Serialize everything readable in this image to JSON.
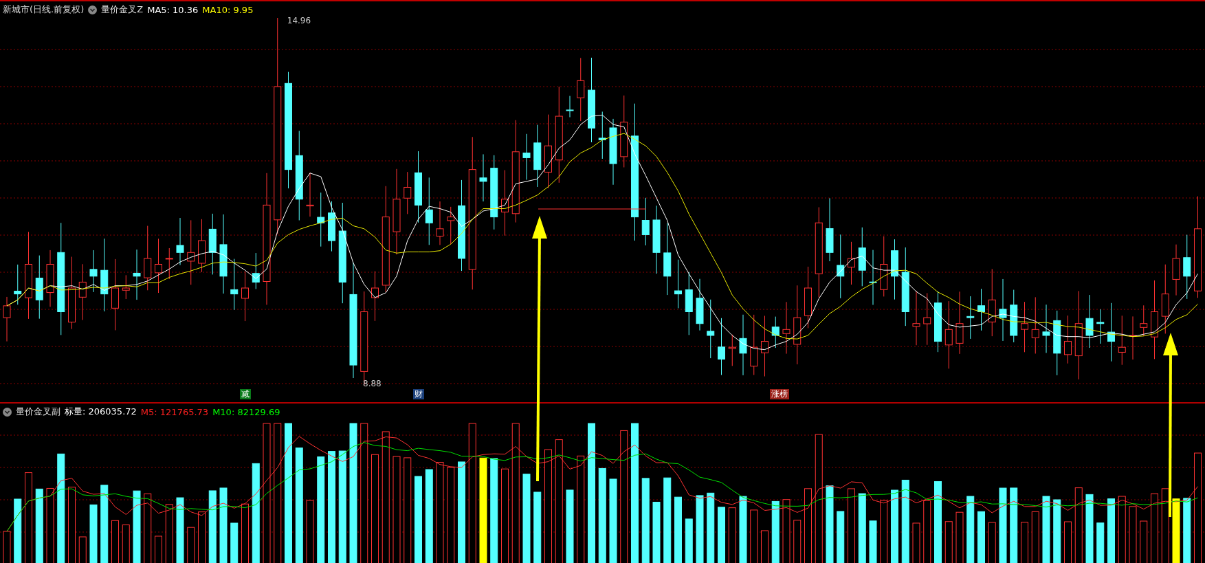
{
  "main_panel": {
    "stock": "新城市(日线.前复权)",
    "indicator": "量价金叉Z",
    "ma5": "MA5: 10.36",
    "ma10": "MA10: 9.95",
    "high_label": "14.96",
    "low_label": "8.88",
    "markers": [
      {
        "text": "减",
        "color": "#0a7a1a"
      },
      {
        "text": "财",
        "color": "#1a3f7a"
      },
      {
        "text": "涨榜",
        "color": "#9a2018"
      }
    ]
  },
  "volume_panel": {
    "indicator": "量价金叉副",
    "volume": "标量: 206035.72",
    "m5": "M5: 121765.73",
    "m10": "M10: 82129.69"
  }
}
